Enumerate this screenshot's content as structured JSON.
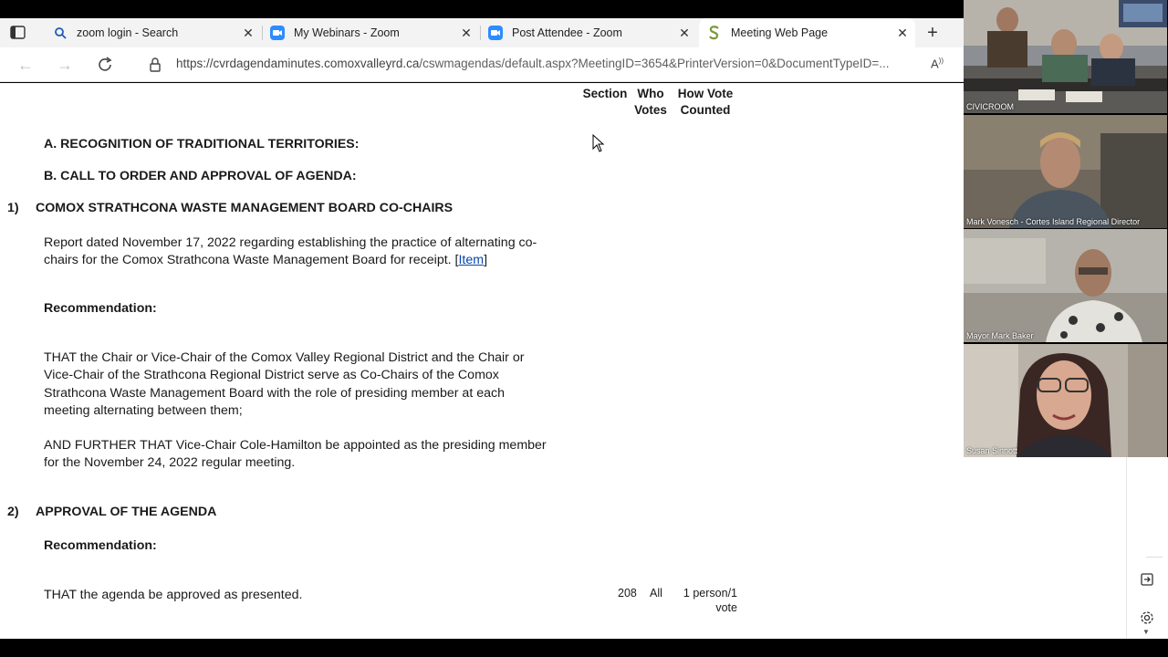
{
  "browser": {
    "tabs": [
      {
        "title": "zoom login - Search",
        "icon": "search-icon"
      },
      {
        "title": "My Webinars - Zoom",
        "icon": "zoom-icon"
      },
      {
        "title": "Post Attendee - Zoom",
        "icon": "zoom-icon"
      },
      {
        "title": "Meeting Web Page",
        "icon": "site-s-icon"
      }
    ],
    "url_main": "https://cvrdagendaminutes.comoxvalleyrd.ca",
    "url_rest": "/cswmagendas/default.aspx?MeetingID=3654&PrinterVersion=0&DocumentTypeID=..."
  },
  "columns": {
    "section": "Section",
    "who_line1": "Who",
    "who_line2": "Votes",
    "how_line1": "How Vote",
    "how_line2": "Counted"
  },
  "agenda": {
    "a_heading": "A. RECOGNITION OF TRADITIONAL TERRITORIES:",
    "b_heading": "B. CALL TO ORDER AND APPROVAL OF AGENDA:",
    "item1": {
      "number": "1)",
      "title": "COMOX STRATHCONA WASTE MANAGEMENT BOARD CO-CHAIRS",
      "report_line1": "Report dated November 17, 2022 regarding establishing the practice of alternating co-",
      "report_line2": "chairs for the Comox Strathcona Waste Management Board for receipt. ",
      "item_link": "Item",
      "rec_label": "Recommendation:",
      "rec_p1_l1": "THAT the Chair or Vice-Chair of the Comox Valley Regional District and the Chair or",
      "rec_p1_l2": "Vice-Chair of the Strathcona Regional District serve as Co-Chairs of the Comox",
      "rec_p1_l3": "Strathcona Waste Management Board with the role of presiding member at each",
      "rec_p1_l4": "meeting alternating between them;",
      "rec_p2_l1": "AND FURTHER THAT Vice-Chair Cole-Hamilton be appointed as the presiding member",
      "rec_p2_l2": "for the November 24, 2022 regular meeting."
    },
    "item2": {
      "number": "2)",
      "title": "APPROVAL OF THE AGENDA",
      "rec_label": "Recommendation:",
      "rec_text": "THAT the agenda be approved as presented.",
      "section": "208",
      "who": "All",
      "how_line1": "1 person/1",
      "how_line2": "vote"
    }
  },
  "zoom": {
    "participants": [
      {
        "label": "CIVICROOM"
      },
      {
        "label": "Mark Vonesch - Cortes Island Regional Director"
      },
      {
        "label": "Mayor Mark Baker"
      },
      {
        "label": "Susan Sinnott"
      }
    ]
  }
}
